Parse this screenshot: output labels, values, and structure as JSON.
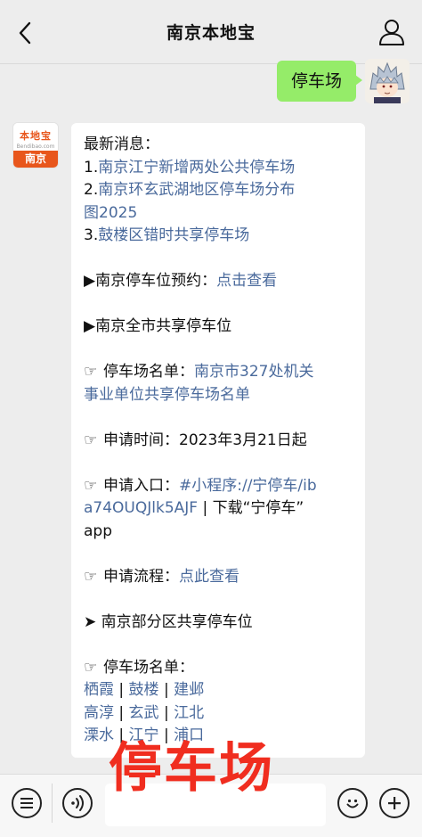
{
  "header": {
    "title": "南京本地宝"
  },
  "outgoing": {
    "text": "停车场"
  },
  "bot_logo": {
    "brand": "本地宝",
    "site": "Bendibao.com",
    "city": "南京"
  },
  "message": {
    "latest_heading": "最新消息：",
    "news": [
      {
        "num": "1.",
        "text": "南京江宁新增两处公共停车场"
      },
      {
        "num": "2.",
        "text_line1": "南京环玄武湖地区停车场分布",
        "text_line2": "图2025"
      },
      {
        "num": "3.",
        "text": "鼓楼区错时共享停车场"
      }
    ],
    "reserve": {
      "mark": "▶",
      "label": "南京停车位预约：",
      "link": "点击查看"
    },
    "citywide": {
      "mark": "▶",
      "label": "南京全市共享停车位"
    },
    "list1": {
      "icon": "☞",
      "label": "停车场名单：",
      "link_line1": "南京市327处机关",
      "link_line2": "事业单位共享停车场名单"
    },
    "apply_time": {
      "icon": "☞",
      "label": "申请时间：",
      "value": "2023年3月21日起"
    },
    "entry": {
      "icon": "☞",
      "label": "申请入口：",
      "link_line1": "#小程序://宁停车/ib",
      "link_line2": "a74OUQJlk5AJF",
      "rest_line2": " | 下载“宁停车”",
      "line3": "app"
    },
    "process": {
      "icon": "☞",
      "label": "申请流程：",
      "link": "点此查看"
    },
    "partial": {
      "mark": "➤",
      "label": "南京部分区共享停车位"
    },
    "list2": {
      "icon": "☞",
      "label": "停车场名单："
    },
    "districts": [
      [
        "栖霞",
        "鼓楼",
        "建邺"
      ],
      [
        "高淳",
        "玄武",
        "江北"
      ],
      [
        "溧水",
        "江宁",
        "浦口"
      ]
    ],
    "separator": " | "
  },
  "overlay_text": "停车场",
  "icons": {
    "back": "chevron-left-icon",
    "profile": "person-icon",
    "menu": "menu-list-icon",
    "voice": "voice-icon",
    "emoji": "emoji-icon",
    "plus": "plus-icon"
  },
  "colors": {
    "link": "#4a6a9c",
    "bubble_out": "#95ec69",
    "brand": "#e8561c",
    "overlay": "#f02d1f"
  }
}
